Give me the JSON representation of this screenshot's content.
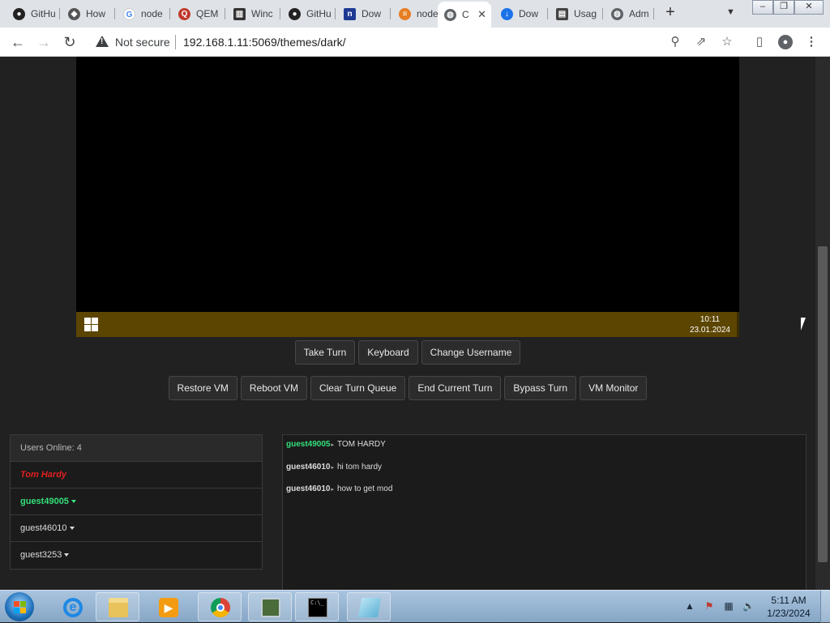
{
  "browser": {
    "tabs": [
      {
        "label": "GitHu",
        "icon": "github-icon"
      },
      {
        "label": "How",
        "icon": "site-icon"
      },
      {
        "label": "node",
        "icon": "google-icon"
      },
      {
        "label": "QEM",
        "icon": "qemu-icon"
      },
      {
        "label": "Winc",
        "icon": "site-icon"
      },
      {
        "label": "GitHu",
        "icon": "github-icon"
      },
      {
        "label": "Dow",
        "icon": "site-icon"
      },
      {
        "label": "node",
        "icon": "site-icon"
      },
      {
        "label": "C",
        "icon": "globe-icon",
        "active": true
      },
      {
        "label": "Dow",
        "icon": "download-icon"
      },
      {
        "label": "Usag",
        "icon": "site-icon"
      },
      {
        "label": "Adm",
        "icon": "globe-icon"
      }
    ],
    "security_label": "Not secure",
    "url": "192.168.1.11:5069/themes/dark/"
  },
  "vm": {
    "clock_time": "10:11",
    "clock_date": "23.01.2024"
  },
  "controls": {
    "row1": [
      "Take Turn",
      "Keyboard",
      "Change Username"
    ],
    "row2": [
      "Restore VM",
      "Reboot VM",
      "Clear Turn Queue",
      "End Current Turn",
      "Bypass Turn",
      "VM Monitor"
    ]
  },
  "users": {
    "header": "Users Online: 4",
    "list": [
      {
        "name": "Tom Hardy",
        "state": "turn"
      },
      {
        "name": "guest49005",
        "state": "active"
      },
      {
        "name": "guest46010",
        "state": "normal"
      },
      {
        "name": "guest3253",
        "state": "normal"
      }
    ]
  },
  "chat": {
    "messages": [
      {
        "user": "guest49005",
        "text": "TOM HARDY",
        "highlight": true
      },
      {
        "user": "guest46010",
        "text": "hi tom hardy",
        "highlight": false
      },
      {
        "user": "guest46010",
        "text": "how to get mod",
        "highlight": false
      }
    ]
  },
  "os_taskbar": {
    "time": "5:11 AM",
    "date": "1/23/2024"
  },
  "colors": {
    "page_bg": "#212121",
    "vm_taskbar": "#5c4500",
    "turn_user": "#e02020",
    "active_user": "#33e07a"
  }
}
